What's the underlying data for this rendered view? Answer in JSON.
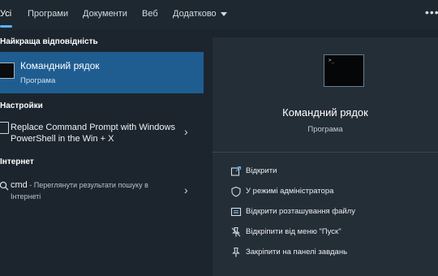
{
  "tabs": {
    "all": "Усі",
    "programs": "Програми",
    "documents": "Документи",
    "web": "Веб",
    "more": "Додатково",
    "overflow": "•••"
  },
  "best_match": {
    "heading": "Найкраща відповідність",
    "title": "Командний рядок",
    "subtitle": "Програма",
    "icon": "command-prompt-icon"
  },
  "settings": {
    "heading": "Настройки",
    "item": "Replace Command Prompt with Windows PowerShell in the Win + X",
    "icon": "settings-doc-icon"
  },
  "internet": {
    "heading": "Інтернет",
    "query": "cmd",
    "hint": " - Переглянути результати пошуку в Інтернеті",
    "icon": "search-icon"
  },
  "preview": {
    "title": "Командний рядок",
    "subtitle": "Програма",
    "prompt_text": ">_"
  },
  "actions": [
    {
      "label": "Відкрити",
      "icon": "open-icon"
    },
    {
      "label": "У режимі адміністратора",
      "icon": "shield-icon"
    },
    {
      "label": "Відкрити розташування файлу",
      "icon": "folder-icon"
    },
    {
      "label": "Відкріпити від меню \"Пуск\"",
      "icon": "unpin-icon"
    },
    {
      "label": "Закріпити на панелі завдань",
      "icon": "pin-icon"
    }
  ],
  "colors": {
    "background": "#1c252d",
    "selected": "#1f5d91",
    "accent": "#5fb2f2",
    "preview_panel": "#242e37"
  }
}
